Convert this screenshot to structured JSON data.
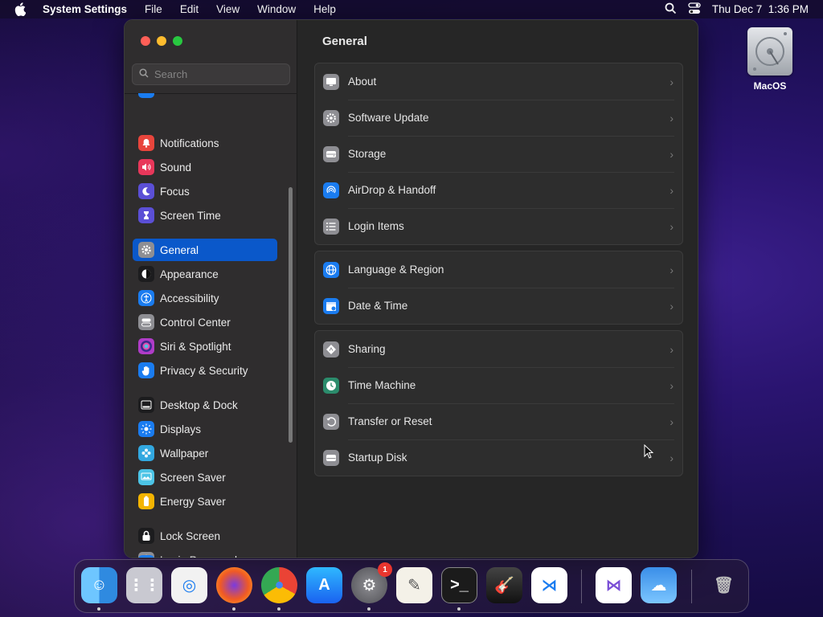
{
  "menubar": {
    "app": "System Settings",
    "menus": [
      "File",
      "Edit",
      "View",
      "Window",
      "Help"
    ],
    "date": "Thu Dec 7",
    "time": "1:36 PM"
  },
  "desktop": {
    "drive_label": "MacOS"
  },
  "window": {
    "search_placeholder": "Search",
    "sidebar": [
      {
        "label": "Notifications",
        "icon": "bell-icon",
        "color": "#e8453c"
      },
      {
        "label": "Sound",
        "icon": "speaker-icon",
        "color": "#e8375a"
      },
      {
        "label": "Focus",
        "icon": "moon-icon",
        "color": "#5b4fd6"
      },
      {
        "label": "Screen Time",
        "icon": "hourglass-icon",
        "color": "#5b4fd6"
      },
      {
        "label": "General",
        "icon": "gear-icon",
        "color": "#8e8e93"
      },
      {
        "label": "Appearance",
        "icon": "appearance-icon",
        "color": "#1c1c1e"
      },
      {
        "label": "Accessibility",
        "icon": "accessibility-icon",
        "color": "#1a7cf0"
      },
      {
        "label": "Control Center",
        "icon": "control-center-icon",
        "color": "#8e8e93"
      },
      {
        "label": "Siri & Spotlight",
        "icon": "siri-icon",
        "color": "#b03cc8"
      },
      {
        "label": "Privacy & Security",
        "icon": "hand-icon",
        "color": "#1a7cf0"
      },
      {
        "label": "Desktop & Dock",
        "icon": "dock-icon",
        "color": "#1c1c1e"
      },
      {
        "label": "Displays",
        "icon": "sun-icon",
        "color": "#1a7cf0"
      },
      {
        "label": "Wallpaper",
        "icon": "flower-icon",
        "color": "#32a8e0"
      },
      {
        "label": "Screen Saver",
        "icon": "screensaver-icon",
        "color": "#4cc4e6"
      },
      {
        "label": "Energy Saver",
        "icon": "battery-icon",
        "color": "#f4b400"
      },
      {
        "label": "Lock Screen",
        "icon": "lock-icon",
        "color": "#1c1c1e"
      },
      {
        "label": "Login Password",
        "icon": "login-icon",
        "color": "#8e8e93"
      }
    ],
    "selected": "General",
    "title": "General",
    "groups": [
      [
        {
          "label": "About",
          "icon": "monitor-icon",
          "color": "#8e8e93"
        },
        {
          "label": "Software Update",
          "icon": "gear-badge-icon",
          "color": "#8e8e93"
        },
        {
          "label": "Storage",
          "icon": "storage-icon",
          "color": "#8e8e93"
        },
        {
          "label": "AirDrop & Handoff",
          "icon": "airdrop-icon",
          "color": "#1a7cf0"
        },
        {
          "label": "Login Items",
          "icon": "list-icon",
          "color": "#8e8e93"
        }
      ],
      [
        {
          "label": "Language & Region",
          "icon": "globe-icon",
          "color": "#1a7cf0"
        },
        {
          "label": "Date & Time",
          "icon": "calendar-icon",
          "color": "#1a7cf0"
        }
      ],
      [
        {
          "label": "Sharing",
          "icon": "sharing-icon",
          "color": "#8e8e93"
        },
        {
          "label": "Time Machine",
          "icon": "clock-icon",
          "color": "#2b8c6c"
        },
        {
          "label": "Transfer or Reset",
          "icon": "reset-icon",
          "color": "#8e8e93"
        },
        {
          "label": "Startup Disk",
          "icon": "disk-icon",
          "color": "#8e8e93"
        }
      ]
    ]
  },
  "dock": {
    "apps": [
      "Finder",
      "Launchpad",
      "Safari",
      "Firefox",
      "Chrome",
      "App Store",
      "System Settings",
      "TextEdit",
      "Terminal",
      "GarageBand",
      "Visual Studio Code",
      "Visual Studio",
      "Weather",
      "Trash"
    ],
    "settings_badge": "1"
  }
}
